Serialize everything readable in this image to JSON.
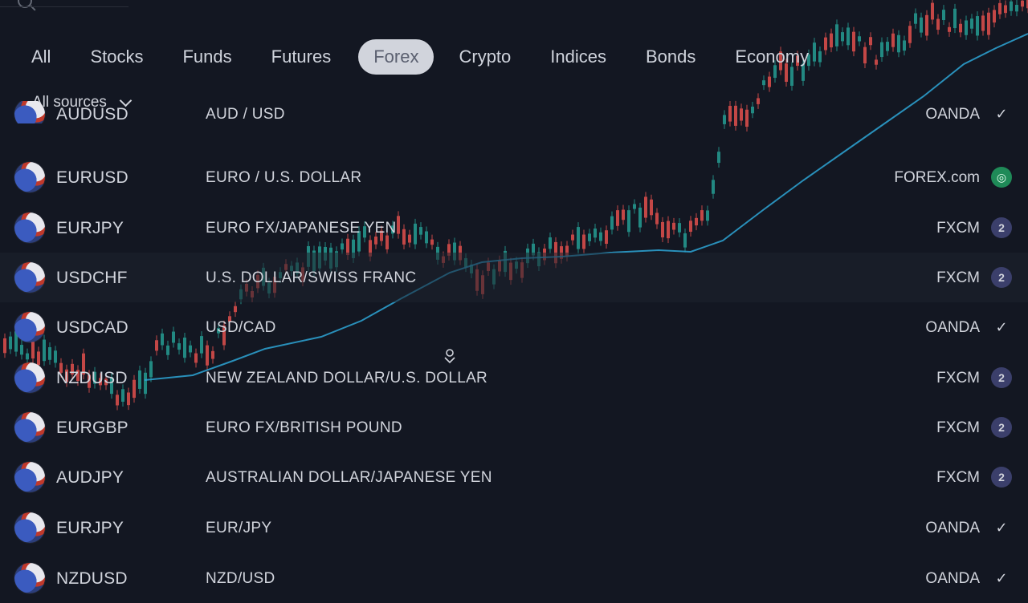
{
  "tabs": [
    {
      "label": "All"
    },
    {
      "label": "Stocks"
    },
    {
      "label": "Funds"
    },
    {
      "label": "Futures"
    },
    {
      "label": "Forex",
      "active": true
    },
    {
      "label": "Crypto"
    },
    {
      "label": "Indices"
    },
    {
      "label": "Bonds"
    },
    {
      "label": "Economy"
    }
  ],
  "sources_label": "All sources",
  "rows": [
    {
      "symbol": "AUDUSD",
      "description": "AUD / USD",
      "source": "OANDA",
      "badge": "✓",
      "badge_type": "oanda",
      "partial": true
    },
    {
      "symbol": "EURUSD",
      "description": "EURO / U.S. DOLLAR",
      "source": "FOREX.com",
      "badge": "◎",
      "badge_type": "forex"
    },
    {
      "symbol": "EURJPY",
      "description": "EURO FX/JAPANESE YEN",
      "source": "FXCM",
      "badge": "2",
      "badge_type": "fxcm"
    },
    {
      "symbol": "USDCHF",
      "description": "U.S. DOLLAR/SWISS FRANC",
      "source": "FXCM",
      "badge": "2",
      "badge_type": "fxcm",
      "highlight": true
    },
    {
      "symbol": "USDCAD",
      "description": "USD/CAD",
      "source": "OANDA",
      "badge": "✓",
      "badge_type": "oanda"
    },
    {
      "symbol": "NZDUSD",
      "description": "NEW ZEALAND DOLLAR/U.S. DOLLAR",
      "source": "FXCM",
      "badge": "2",
      "badge_type": "fxcm"
    },
    {
      "symbol": "EURGBP",
      "description": "EURO FX/BRITISH POUND",
      "source": "FXCM",
      "badge": "2",
      "badge_type": "fxcm"
    },
    {
      "symbol": "AUDJPY",
      "description": "AUSTRALIAN DOLLAR/JAPANESE YEN",
      "source": "FXCM",
      "badge": "2",
      "badge_type": "fxcm"
    },
    {
      "symbol": "EURJPY",
      "description": "EUR/JPY",
      "source": "OANDA",
      "badge": "✓",
      "badge_type": "oanda"
    },
    {
      "symbol": "NZDUSD",
      "description": "NZD/USD",
      "source": "OANDA",
      "badge": "✓",
      "badge_type": "oanda",
      "partial": true
    }
  ],
  "colors": {
    "background": "#131722",
    "text": "#d1d4dc",
    "active_tab_bg": "#d1d4dc",
    "candle_up": "#26a69a",
    "candle_down": "#ef5350",
    "ma_line": "#2ea6d6"
  }
}
